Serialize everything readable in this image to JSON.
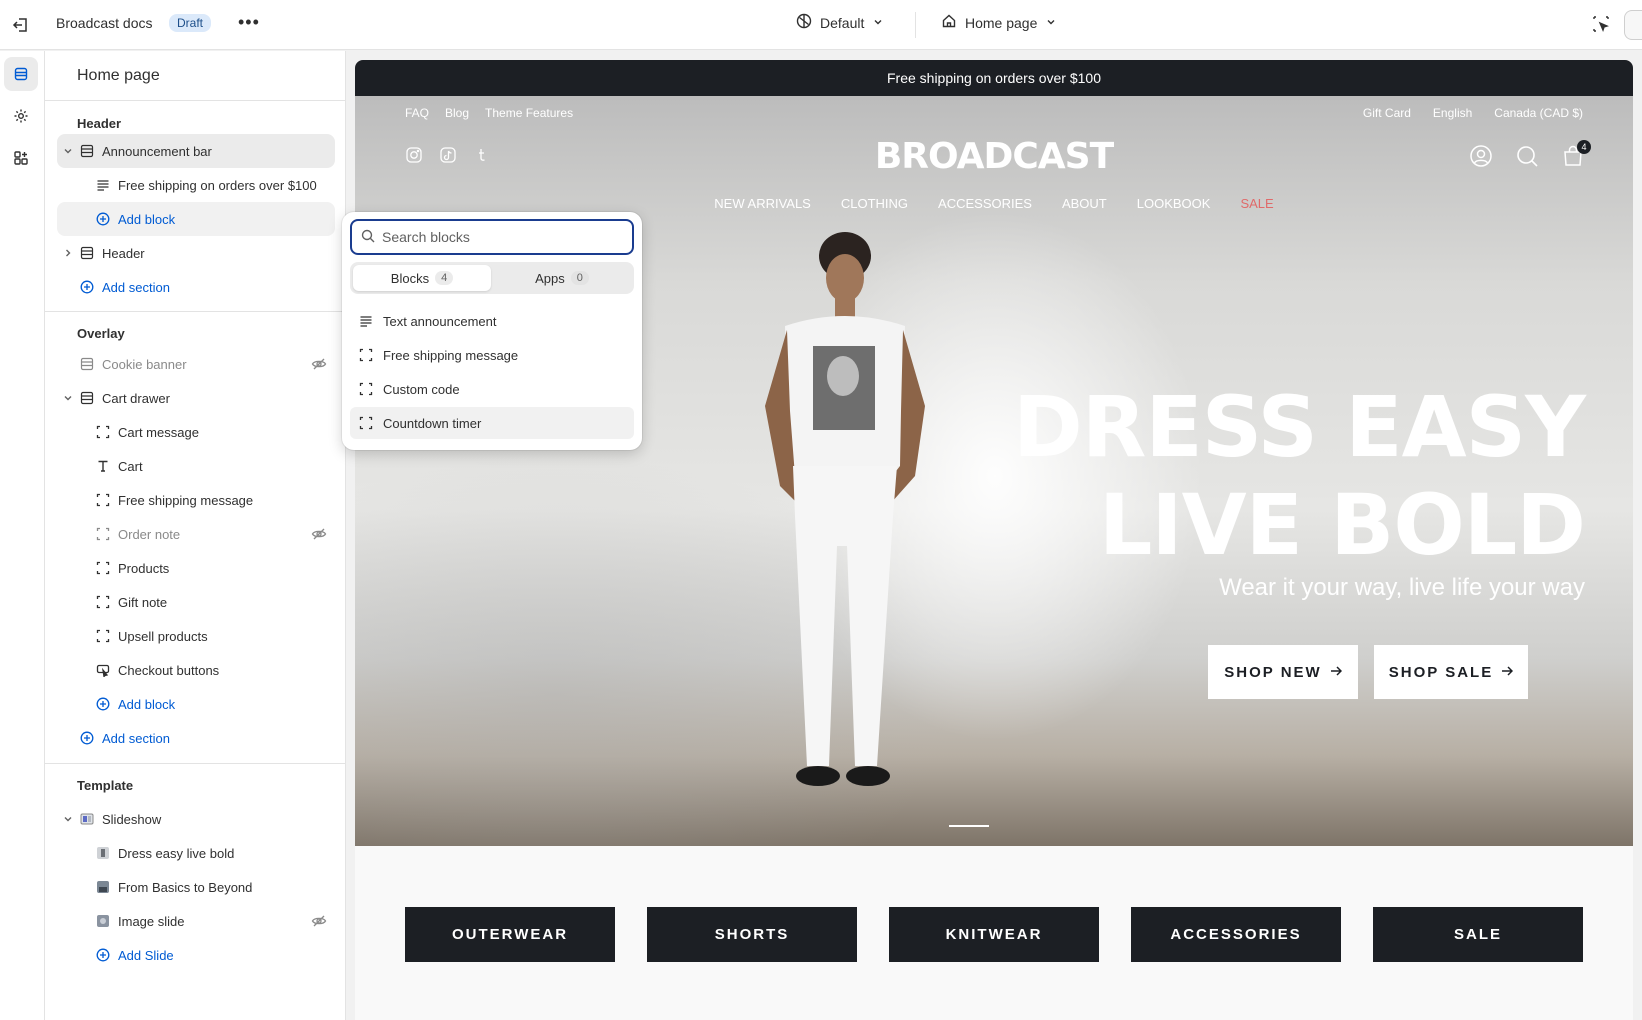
{
  "topbar": {
    "store_title": "Broadcast docs",
    "status_badge": "Draft",
    "more_label": "•••",
    "theme_selector": "Default",
    "page_selector": "Home page"
  },
  "sidebar": {
    "title": "Home page",
    "groups": {
      "header": "Header",
      "overlay": "Overlay",
      "template": "Template"
    },
    "header_rows": {
      "announcement_bar": "Announcement bar",
      "free_shipping": "Free shipping on orders over $100",
      "add_block": "Add block",
      "header": "Header",
      "add_section": "Add section"
    },
    "overlay_rows": {
      "cookie_banner": "Cookie banner",
      "cart_drawer": "Cart drawer",
      "cart_message": "Cart message",
      "cart": "Cart",
      "free_shipping_message": "Free shipping message",
      "order_note": "Order note",
      "products": "Products",
      "gift_note": "Gift note",
      "upsell_products": "Upsell products",
      "checkout_buttons": "Checkout buttons",
      "add_block": "Add block",
      "add_section": "Add section"
    },
    "template_rows": {
      "slideshow": "Slideshow",
      "dress_easy": "Dress easy live bold",
      "from_basics": "From Basics to Beyond",
      "image_slide": "Image slide",
      "add_slide": "Add Slide"
    }
  },
  "popover": {
    "search_placeholder": "Search blocks",
    "tabs": [
      {
        "label": "Blocks",
        "count": "4"
      },
      {
        "label": "Apps",
        "count": "0"
      }
    ],
    "items": [
      "Text announcement",
      "Free shipping message",
      "Custom code",
      "Countdown timer"
    ]
  },
  "preview": {
    "announcement": "Free shipping on orders over $100",
    "utility_left": [
      "FAQ",
      "Blog",
      "Theme Features"
    ],
    "utility_right": [
      "Gift Card",
      "English",
      "Canada (CAD $)"
    ],
    "logo": "BROADCAST",
    "cart_count": "4",
    "nav": [
      "NEW ARRIVALS",
      "CLOTHING",
      "ACCESSORIES",
      "ABOUT",
      "LOOKBOOK",
      "SALE"
    ],
    "headline_line1": "DRESS EASY",
    "headline_line2": "LIVE BOLD",
    "subheadline": "Wear it your way, live life your way",
    "buttons": [
      "SHOP NEW",
      "SHOP SALE"
    ],
    "collections": [
      "OUTERWEAR",
      "SHORTS",
      "KNITWEAR",
      "ACCESSORIES",
      "SALE"
    ]
  },
  "colors": {
    "accent_blue": "#005bd3",
    "dark": "#1c1f24",
    "sale_red": "#e06a6a",
    "badge_bg": "#dbe9fa"
  }
}
